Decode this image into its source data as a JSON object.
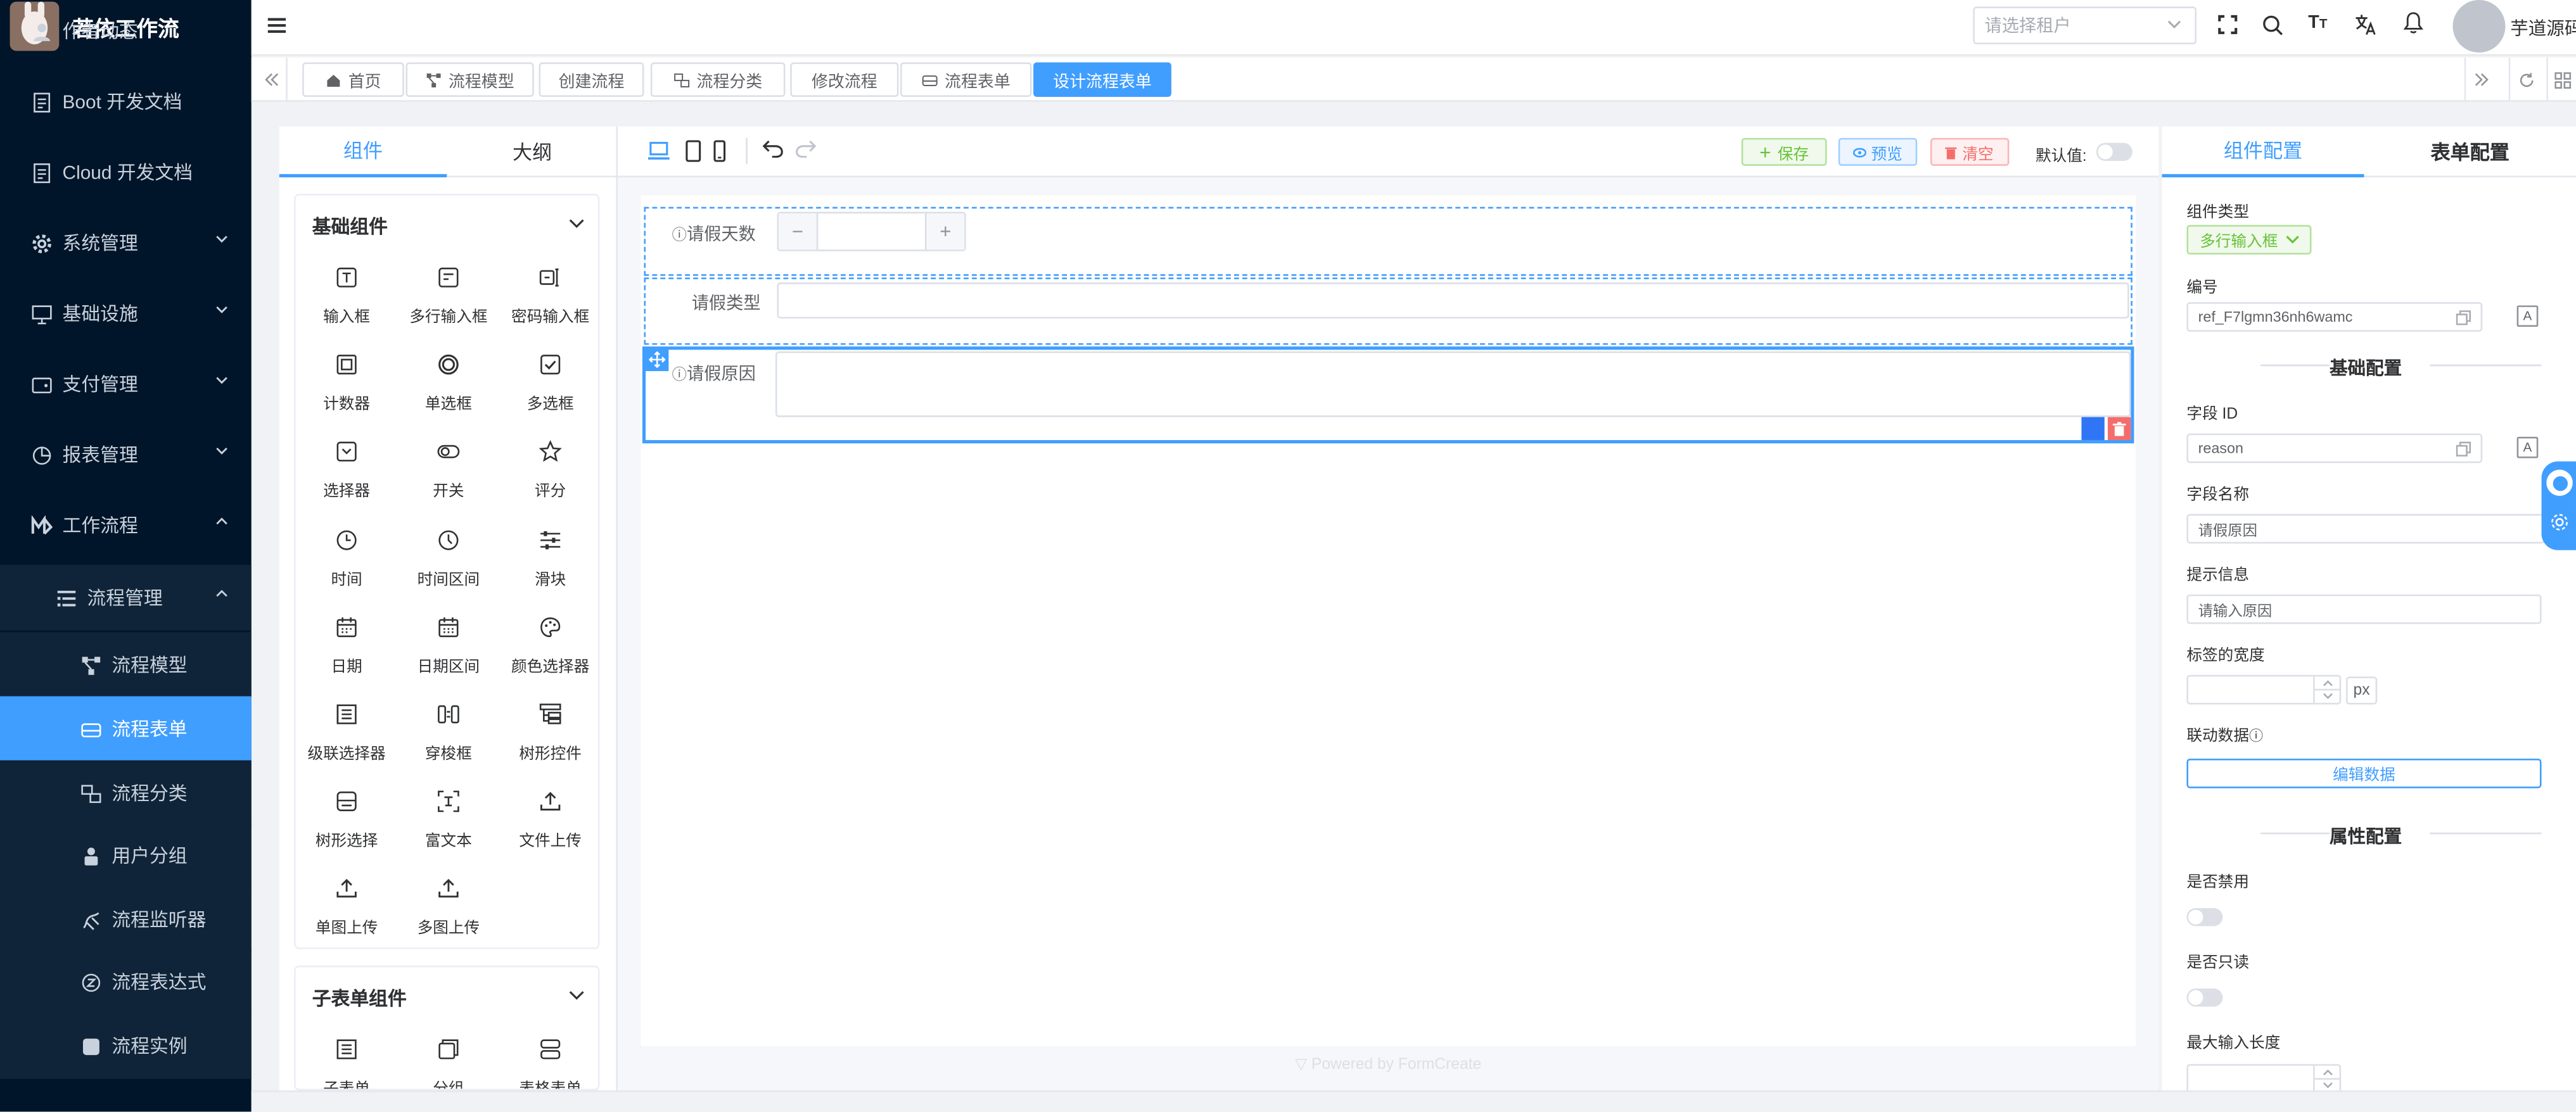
{
  "app": {
    "name": "若依工作流"
  },
  "colors": {
    "primary": "#409eff",
    "sidebar_bg": "#001529",
    "danger": "#f56c6c",
    "success": "#67c23a"
  },
  "sidebar": {
    "items": [
      {
        "label": "作者动态",
        "icon": "user-icon"
      },
      {
        "label": "Boot 开发文档",
        "icon": "document-icon"
      },
      {
        "label": "Cloud 开发文档",
        "icon": "document-icon"
      },
      {
        "label": "系统管理",
        "icon": "gear-icon"
      },
      {
        "label": "基础设施",
        "icon": "monitor-icon"
      },
      {
        "label": "支付管理",
        "icon": "wallet-icon"
      },
      {
        "label": "报表管理",
        "icon": "chart-icon"
      },
      {
        "label": "工作流程",
        "icon": "workflow-icon"
      },
      {
        "label": "流程管理",
        "icon": "list-icon"
      },
      {
        "label": "流程模型",
        "icon": "model-icon"
      },
      {
        "label": "流程表单",
        "icon": "form-icon"
      },
      {
        "label": "流程分类",
        "icon": "category-icon"
      },
      {
        "label": "用户分组",
        "icon": "group-icon"
      },
      {
        "label": "流程监听器",
        "icon": "listener-icon"
      },
      {
        "label": "流程表达式",
        "icon": "expression-icon"
      },
      {
        "label": "流程实例",
        "icon": "instance-icon"
      }
    ]
  },
  "header": {
    "tenant_placeholder": "请选择租户",
    "user_name": "芋道源码"
  },
  "tabs": [
    {
      "label": "首页",
      "icon": "home-icon"
    },
    {
      "label": "流程模型",
      "icon": "model-icon"
    },
    {
      "label": "创建流程",
      "icon": ""
    },
    {
      "label": "流程分类",
      "icon": "category-icon"
    },
    {
      "label": "修改流程",
      "icon": ""
    },
    {
      "label": "流程表单",
      "icon": "form-icon"
    },
    {
      "label": "设计流程表单",
      "icon": ""
    }
  ],
  "left_panel": {
    "tabs": [
      "组件",
      "大纲"
    ],
    "basic_title": "基础组件",
    "basic_components": [
      {
        "label": "输入框",
        "icon": "input-icon"
      },
      {
        "label": "多行输入框",
        "icon": "textarea-icon"
      },
      {
        "label": "密码输入框",
        "icon": "password-icon"
      },
      {
        "label": "计数器",
        "icon": "counter-icon"
      },
      {
        "label": "单选框",
        "icon": "radio-icon"
      },
      {
        "label": "多选框",
        "icon": "checkbox-icon"
      },
      {
        "label": "选择器",
        "icon": "select-icon"
      },
      {
        "label": "开关",
        "icon": "switch-icon"
      },
      {
        "label": "评分",
        "icon": "star-icon"
      },
      {
        "label": "时间",
        "icon": "clock-icon"
      },
      {
        "label": "时间区间",
        "icon": "clock-range-icon"
      },
      {
        "label": "滑块",
        "icon": "slider-icon"
      },
      {
        "label": "日期",
        "icon": "calendar-icon"
      },
      {
        "label": "日期区间",
        "icon": "calendar-range-icon"
      },
      {
        "label": "颜色选择器",
        "icon": "palette-icon"
      },
      {
        "label": "级联选择器",
        "icon": "cascader-icon"
      },
      {
        "label": "穿梭框",
        "icon": "transfer-icon"
      },
      {
        "label": "树形控件",
        "icon": "tree-icon"
      },
      {
        "label": "树形选择",
        "icon": "tree-select-icon"
      },
      {
        "label": "富文本",
        "icon": "rich-text-icon"
      },
      {
        "label": "文件上传",
        "icon": "upload-icon"
      },
      {
        "label": "单图上传",
        "icon": "upload-icon"
      },
      {
        "label": "多图上传",
        "icon": "upload-icon"
      }
    ],
    "sub_title": "子表单组件",
    "sub_components": [
      {
        "label": "子表单",
        "icon": "subform-icon"
      },
      {
        "label": "分组",
        "icon": "group-box-icon"
      },
      {
        "label": "表格表单",
        "icon": "table-form-icon"
      }
    ]
  },
  "toolbar": {
    "save": "保存",
    "preview": "预览",
    "clear": "清空",
    "default_label": "默认值:"
  },
  "canvas": {
    "fields": [
      {
        "label": "请假天数",
        "type": "counter",
        "has_info": true
      },
      {
        "label": "请假类型",
        "type": "input",
        "has_info": false
      },
      {
        "label": "请假原因",
        "type": "textarea",
        "has_info": true
      }
    ],
    "counter_minus": "−",
    "counter_plus": "+",
    "footer": "Powered by FormCreate"
  },
  "right_panel": {
    "tabs": [
      "组件配置",
      "表单配置"
    ],
    "component_type_label": "组件类型",
    "component_type_value": "多行输入框",
    "id_label": "编号",
    "id_value": "ref_F7lgmn36nh6wamc",
    "basic_section": "基础配置",
    "field_id_label": "字段 ID",
    "field_id_value": "reason",
    "field_name_label": "字段名称",
    "field_name_value": "请假原因",
    "hint_label": "提示信息",
    "hint_value": "请输入原因",
    "label_width_label": "标签的宽度",
    "label_width_unit": "px",
    "linkage_label": "联动数据",
    "edit_data_button": "编辑数据",
    "attr_section": "属性配置",
    "disabled_label": "是否禁用",
    "readonly_label": "是否只读",
    "maxlength_label": "最大输入长度"
  }
}
